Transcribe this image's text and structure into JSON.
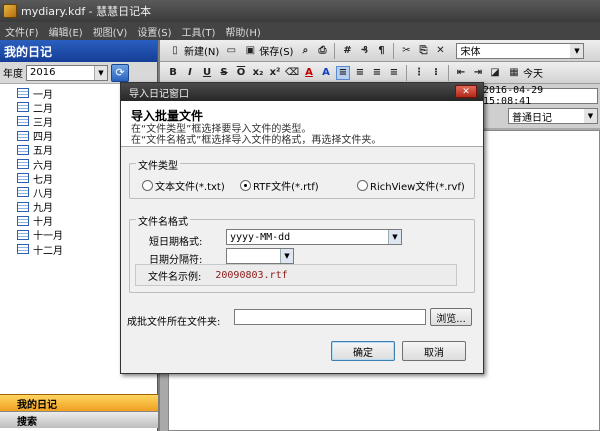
{
  "window": {
    "title": "mydiary.kdf - 慧慧日记本"
  },
  "menu": [
    "文件(F)",
    "编辑(E)",
    "视图(V)",
    "设置(S)",
    "工具(T)",
    "帮助(H)"
  ],
  "left": {
    "header": "我的日记",
    "year_label": "年度",
    "year_value": "2016",
    "months": [
      "一月",
      "二月",
      "三月",
      "四月",
      "五月",
      "六月",
      "七月",
      "八月",
      "九月",
      "十月",
      "十一月",
      "十二月"
    ],
    "nav_diary": "我的日记",
    "nav_search": "搜索"
  },
  "toolbar": {
    "new": "新建(N)",
    "save": "保存(S)",
    "font": "宋体",
    "today": "今天"
  },
  "entry": {
    "datetime": "2016-04-29 15:08:41",
    "category": "普通日记"
  },
  "dialog": {
    "title": "导入日记窗口",
    "heading": "导入批量文件",
    "desc1": "在“文件类型”框选择要导入文件的类型。",
    "desc2": "在“文件名格式”框选择导入文件的格式，再选择文件夹。",
    "filetype_group": "文件类型",
    "radio_txt": "文本文件(*.txt)",
    "radio_rtf": "RTF文件(*.rtf)",
    "radio_rvf": "RichView文件(*.rvf)",
    "selected_type": "rtf",
    "format_group": "文件名格式",
    "short_date_label": "短日期格式:",
    "short_date_value": "yyyy-MM-dd",
    "separator_label": "日期分隔符:",
    "separator_value": "",
    "example_label": "文件名示例:",
    "example_value": "20090803.rtf",
    "folder_label": "成批文件所在文件夹:",
    "folder_value": "",
    "browse": "浏览...",
    "ok": "确定",
    "cancel": "取消"
  }
}
